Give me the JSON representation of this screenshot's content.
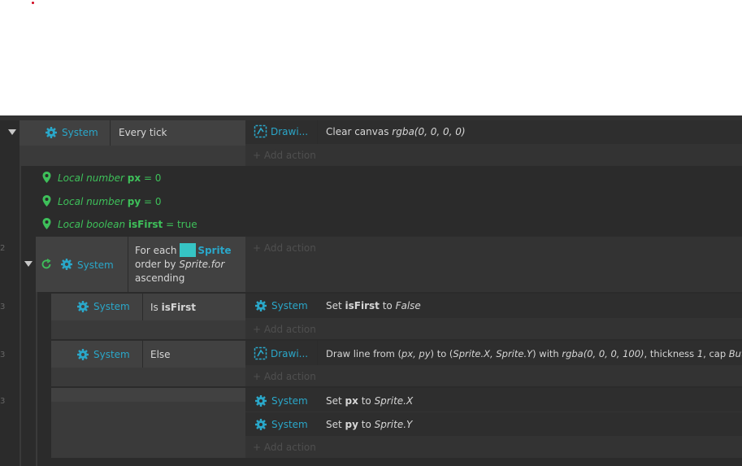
{
  "events": {
    "every_tick": {
      "object": "System",
      "condition": "Every tick",
      "action": {
        "object": "Drawi...",
        "prefix": "Clear canvas ",
        "arg": "rgba(0, 0, 0, 0)"
      },
      "add_action": "+ Add action"
    },
    "locals": [
      {
        "kw": "Local number ",
        "name": "px",
        "rest": " = 0"
      },
      {
        "kw": "Local number ",
        "name": "py",
        "rest": " = 0"
      },
      {
        "kw": "Local boolean ",
        "name": "isFirst",
        "rest": " = true"
      }
    ],
    "for_each": {
      "object": "System",
      "line1_prefix": "For each ",
      "line1_obj": "Sprite",
      "line2_prefix": "order by ",
      "line2_expr": "Sprite.for",
      "line3": "ascending",
      "add_action": "+ Add action"
    },
    "is_first": {
      "object": "System",
      "cond_prefix": "Is ",
      "cond_var": "isFirst",
      "action_object": "System",
      "action_p1": "Set ",
      "action_var": "isFirst",
      "action_p2": " to ",
      "action_val": "False",
      "add_action": "+ Add action"
    },
    "else_block": {
      "object": "System",
      "condition": "Else",
      "action_object": "Drawi...",
      "a1": "Draw line from (",
      "a2": "px, py",
      "a3": ") to (",
      "a4": "Sprite.X, Sprite.Y",
      "a5": ") with ",
      "a6": "rgba(0, 0, 0, 100)",
      "a7": ", thickness ",
      "a8": "1",
      "a9": ", cap ",
      "a10": "Butt",
      "add_action": "+ Add action"
    },
    "set_pos": {
      "row1_object": "System",
      "row1_p1": "Set ",
      "row1_var": "px",
      "row1_p2": " to ",
      "row1_val": "Sprite.X",
      "row2_object": "System",
      "row2_p1": "Set ",
      "row2_var": "py",
      "row2_p2": " to ",
      "row2_val": "Sprite.Y",
      "add_action": "+ Add action"
    }
  },
  "colors": {
    "object_blue": "#2aa7c9",
    "local_green": "#3ec05a",
    "sprite_teal": "#36c4c4",
    "sheet_bg": "#2b2b2b"
  },
  "icons": {
    "system": "gear-icon",
    "drawing": "drawing-canvas-icon",
    "local": "map-pin-icon",
    "loop": "loop-icon",
    "collapse": "triangle-down-icon"
  }
}
